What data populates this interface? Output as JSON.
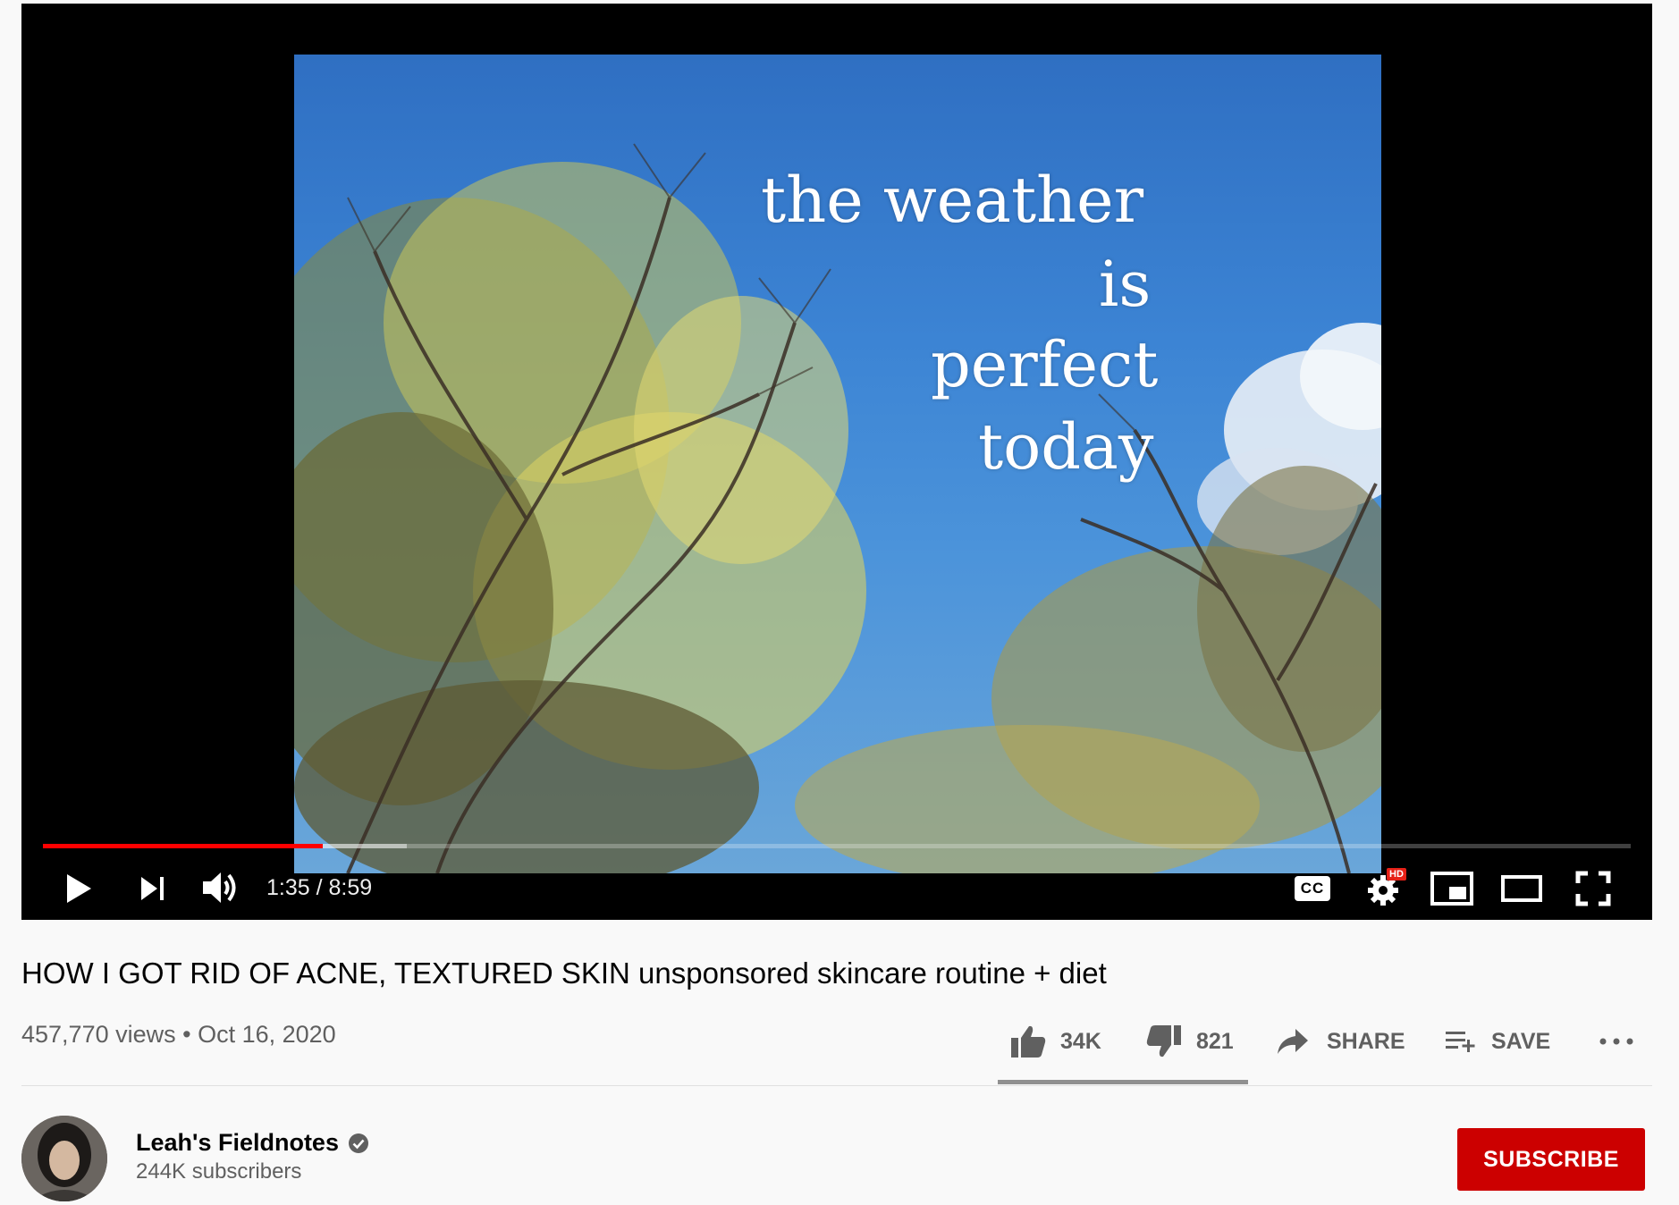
{
  "player": {
    "overlay_lines": [
      "the weather",
      "is",
      "perfect",
      "today"
    ],
    "progress_played_fraction": 0.176,
    "progress_buffered_fraction": 0.229,
    "current_time": "1:35",
    "duration": "8:59",
    "time_display": "1:35 / 8:59",
    "cc_label": "CC",
    "hd_badge": "HD",
    "accent_color": "#ff0000"
  },
  "video": {
    "title": "HOW I GOT RID OF ACNE, TEXTURED SKIN unsponsored skincare routine + diet",
    "meta": "457,770 views • Oct 16, 2020"
  },
  "actions": {
    "like_count": "34K",
    "dislike_count": "821",
    "share_label": "SHARE",
    "save_label": "SAVE",
    "like_ratio": 0.976
  },
  "channel": {
    "name": "Leah's Fieldnotes",
    "subscribers": "244K subscribers",
    "subscribe_label": "SUBSCRIBE",
    "subscribe_color": "#cc0000"
  }
}
